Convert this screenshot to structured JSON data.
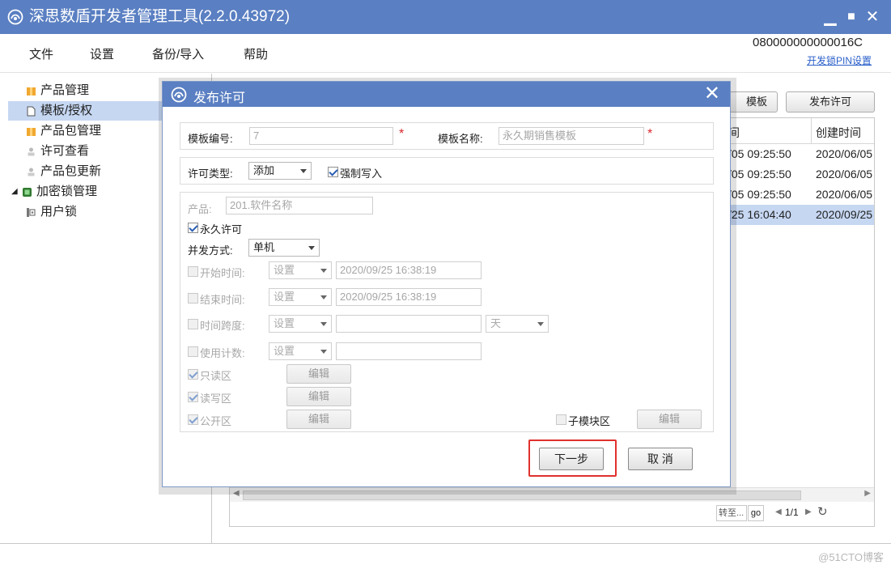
{
  "app": {
    "title": "深思数盾开发者管理工具(2.2.0.43972)",
    "accent": "#5a7fc2",
    "controls": {
      "minimize": "▁",
      "maximize": "■",
      "close": "✕"
    }
  },
  "menu": {
    "items": [
      "文件",
      "设置",
      "备份/导入",
      "帮助"
    ],
    "device_id": "080000000000016C",
    "pin_link": "开发锁PIN设置"
  },
  "tree": {
    "items": [
      {
        "label": "产品管理",
        "icon": "box-icon"
      },
      {
        "label": "模板/授权",
        "icon": "document-icon"
      },
      {
        "label": "产品包管理",
        "icon": "box-icon"
      },
      {
        "label": "许可查看",
        "icon": "person-icon"
      },
      {
        "label": "产品包更新",
        "icon": "person-icon"
      },
      {
        "label": "加密锁管理",
        "icon": "chip-icon"
      },
      {
        "label": "用户锁",
        "icon": "user-lock-icon"
      }
    ]
  },
  "main": {
    "buttons": {
      "template_partial": "模板",
      "publish": "发布许可"
    },
    "grid": {
      "headers": [
        "间",
        "创建时间"
      ],
      "rows": [
        [
          "/05 09:25:50",
          "2020/06/05"
        ],
        [
          "/05 09:25:50",
          "2020/06/05"
        ],
        [
          "/05 09:25:50",
          "2020/06/05"
        ],
        [
          "/25 16:04:40",
          "2020/09/25"
        ]
      ]
    },
    "pager": {
      "goto_placeholder": "转至...",
      "go": "go",
      "page": "1/1"
    }
  },
  "dialog": {
    "title": "发布许可",
    "template_no_label": "模板编号:",
    "template_no_value": "7",
    "template_name_label": "模板名称:",
    "template_name_value": "永久期销售模板",
    "required_mark": "*",
    "license_type_label": "许可类型:",
    "license_type_value": "添加",
    "force_write_label": "强制写入",
    "product_label": "产品:",
    "product_value": "201.软件名称",
    "permanent_label": "永久许可",
    "concurrency_label": "并发方式:",
    "concurrency_value": "单机",
    "start_time_label": "开始时间:",
    "start_time_mode": "设置",
    "start_time_value": "2020/09/25 16:38:19",
    "end_time_label": "结束时间:",
    "end_time_mode": "设置",
    "end_time_value": "2020/09/25 16:38:19",
    "span_label": "时间跨度:",
    "span_mode": "设置",
    "span_unit": "天",
    "count_label": "使用计数:",
    "count_mode": "设置",
    "readonly_label": "只读区",
    "readwrite_label": "读写区",
    "public_label": "公开区",
    "submodule_label": "子模块区",
    "edit_label": "编辑",
    "next_label": "下一步",
    "cancel_label": "取 消"
  },
  "watermark": "@51CTO博客"
}
